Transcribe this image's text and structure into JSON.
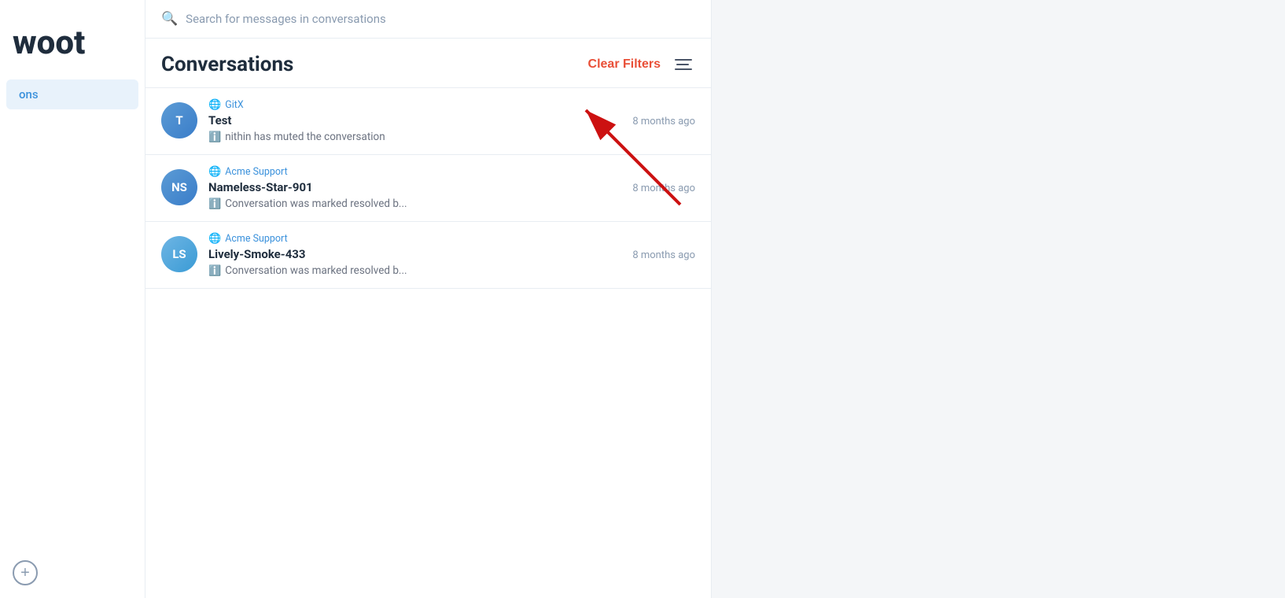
{
  "sidebar": {
    "logo": "woot",
    "nav_item": "ons",
    "add_button_label": "+"
  },
  "search": {
    "placeholder": "Search for messages in conversations"
  },
  "header": {
    "title": "Conversations",
    "clear_filters_label": "Clear Filters",
    "filter_icon_label": "filter-icon"
  },
  "conversations": [
    {
      "id": 1,
      "avatar_initials": "T",
      "avatar_class": "avatar-blue",
      "inbox": "GitX",
      "name": "Test",
      "time": "8 months ago",
      "message": "nithin has muted the conversation"
    },
    {
      "id": 2,
      "avatar_initials": "NS",
      "avatar_class": "avatar-blue-ns",
      "inbox": "Acme Support",
      "name": "Nameless-Star-901",
      "time": "8 months ago",
      "message": "Conversation was marked resolved b..."
    },
    {
      "id": 3,
      "avatar_initials": "LS",
      "avatar_class": "avatar-blue-ls",
      "inbox": "Acme Support",
      "name": "Lively-Smoke-433",
      "time": "8 months ago",
      "message": "Conversation was marked resolved b..."
    }
  ],
  "colors": {
    "clear_filters": "#e94f37",
    "arrow": "#cc1111"
  }
}
